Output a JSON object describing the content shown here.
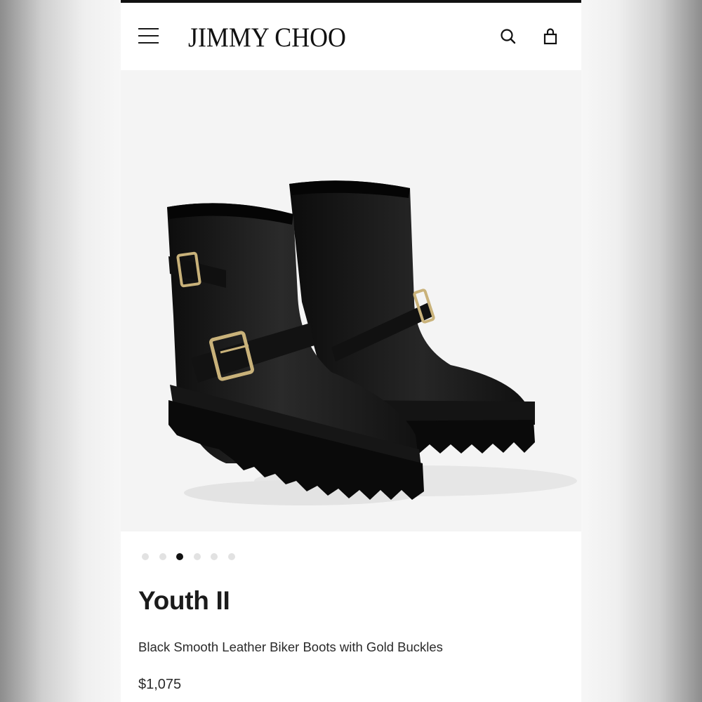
{
  "header": {
    "logo_text": "JIMMY CHOO",
    "icons": [
      "menu-icon",
      "search-icon",
      "shopping-bag-icon"
    ]
  },
  "gallery": {
    "image_description_icon": "product-photo",
    "page_count": 6,
    "active_page": 3
  },
  "product": {
    "name": "Youth II",
    "description": "Black Smooth Leather Biker Boots with Gold Buckles",
    "price": "$1,075"
  },
  "colors": {
    "accent": "#111111",
    "image_bg": "#f4f4f4",
    "buckle_gold": "#c9b27a"
  }
}
